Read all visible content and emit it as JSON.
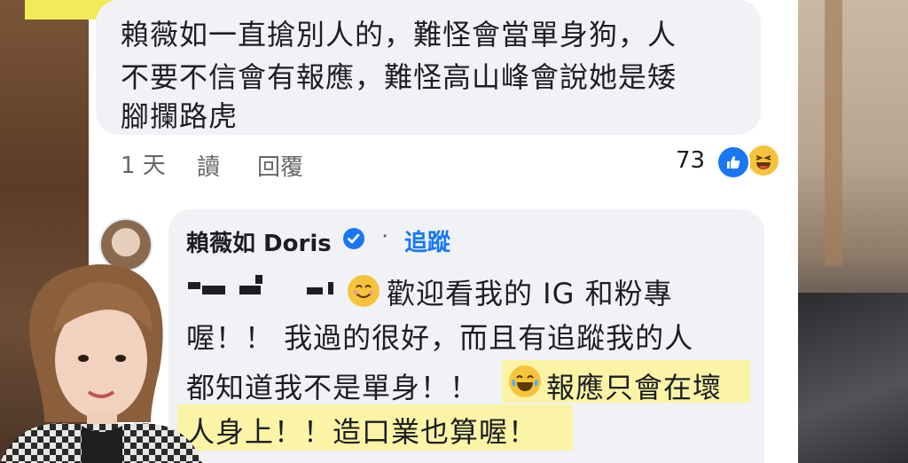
{
  "comment1": {
    "lines": [
      "賴薇如一直搶別人的，難怪會當單身狗，人",
      "不要不信會有報應，難怪高山峰會說她是矮",
      "腳攔路虎"
    ],
    "time": "1 天",
    "read_label": "讀",
    "reply_label": "回覆",
    "reaction_count": "73",
    "reactions": [
      "like-icon",
      "haha-icon"
    ]
  },
  "comment2": {
    "author": "賴薇如 Doris",
    "separator": "·",
    "follow_label": "追蹤",
    "lines": [
      "歡迎看我的 IG 和粉專",
      "喔！！ 我過的很好，而且有追蹤我的人",
      "都知道我不是單身！！",
      "報應只會在壞",
      "人身上！！造口業也算喔！"
    ]
  },
  "colors": {
    "accent": "#1877f2",
    "highlight": "#fbf4a6",
    "bubble": "#f0f2f5"
  }
}
